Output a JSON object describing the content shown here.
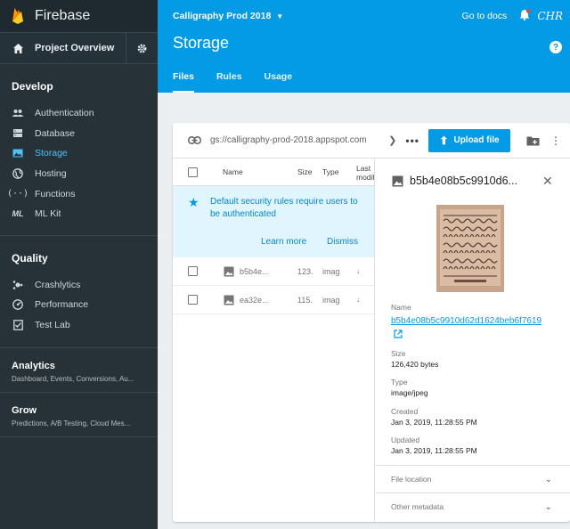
{
  "brand": {
    "name": "Firebase"
  },
  "sidebar": {
    "project_overview": "Project Overview",
    "sections": [
      {
        "title": "Develop",
        "items": [
          "Authentication",
          "Database",
          "Storage",
          "Hosting",
          "Functions",
          "ML Kit"
        ],
        "active": "Storage"
      },
      {
        "title": "Quality",
        "items": [
          "Crashlytics",
          "Performance",
          "Test Lab"
        ]
      }
    ],
    "groups": [
      {
        "title": "Analytics",
        "subtitle": "Dashboard, Events, Conversions, Au..."
      },
      {
        "title": "Grow",
        "subtitle": "Predictions, A/B Testing, Cloud Mes..."
      }
    ]
  },
  "header": {
    "project": "Calligraphy Prod 2018",
    "docs": "Go to docs",
    "avatar": "CHR",
    "title": "Storage",
    "help": "?",
    "tabs": [
      "Files",
      "Rules",
      "Usage"
    ],
    "active_tab": "Files"
  },
  "toolbar": {
    "path": "gs://calligraphy-prod-2018.appspot.com",
    "upload_label": "Upload file"
  },
  "list": {
    "columns": [
      "Name",
      "Size",
      "Type",
      "Last modif"
    ],
    "notice": "Default security rules require users to be authenticated",
    "learn_more": "Learn more",
    "dismiss": "Dismiss",
    "rows": [
      {
        "name": "b5b4e...",
        "size": "123.",
        "type": "imag",
        "dl": "↓"
      },
      {
        "name": "ea32e...",
        "size": "115.",
        "type": "imag",
        "dl": "↓"
      }
    ]
  },
  "details": {
    "name": "b5b4e08b5c9910d6...",
    "name_label": "Name",
    "full_name": "b5b4e08b5c9910d62d1624beb6f7619",
    "size_label": "Size",
    "size": "126,420 bytes",
    "type_label": "Type",
    "type": "image/jpeg",
    "created_label": "Created",
    "created": "Jan 3, 2019, 11:28:55 PM",
    "updated_label": "Updated",
    "updated": "Jan 3, 2019, 11:28:55 PM",
    "file_location": "File location",
    "other_metadata": "Other metadata"
  },
  "colors": {
    "accent": "#039be5",
    "sidebar": "#263238",
    "active_nav": "#4fc3f7",
    "notice_bg": "#e1f5fe"
  }
}
